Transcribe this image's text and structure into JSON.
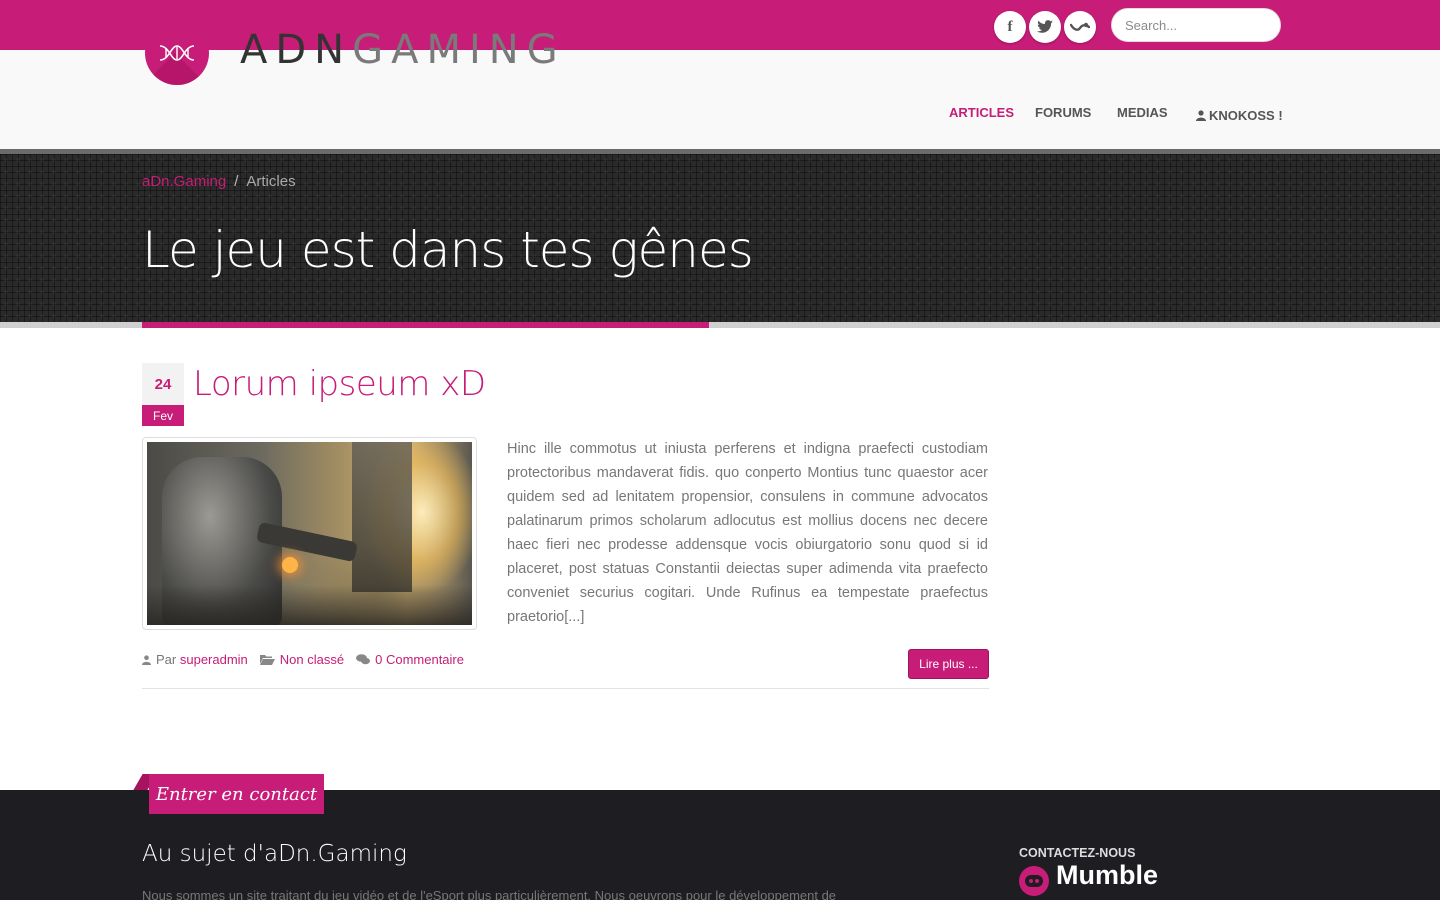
{
  "topbar": {
    "social": [
      {
        "name": "facebook",
        "icon": "facebook-icon",
        "glyph": "f"
      },
      {
        "name": "twitter",
        "icon": "twitter-icon"
      },
      {
        "name": "steam",
        "icon": "steam-icon"
      }
    ],
    "search_placeholder": "Search..."
  },
  "header": {
    "logo_text_primary": "ADN",
    "logo_text_secondary": "GAMING",
    "nav": [
      {
        "label": "ARTICLES",
        "active": true
      },
      {
        "label": "FORUMS",
        "active": false
      },
      {
        "label": "MEDIAS",
        "active": false
      },
      {
        "label": "KNOKOSS !",
        "active": false,
        "icon": "user-icon"
      }
    ]
  },
  "hero": {
    "breadcrumb": {
      "home": "aDn.Gaming",
      "separator": "/",
      "current": "Articles"
    },
    "title": "Le jeu est dans tes gênes"
  },
  "post": {
    "date_day": "24",
    "date_month": "Fev",
    "title": "Lorum ipseum xD",
    "excerpt": "Hinc ille commotus ut iniusta perferens et indigna praefecti custodiam protectoribus mandaverat fidis. quo conperto Montius tunc quaestor acer quidem sed ad lenitatem propensior, consulens in commune advocatos palatinarum primos scholarum adlocutus est mollius docens nec decere haec fieri nec prodesse addensque vocis obiurgatorio sonu quod si id placeret, post statuas Constantii deiectas super adimenda vita praefecto conveniet securius cogitari. Unde Rufinus ea tempestate praefectus praetorio[...]",
    "meta": {
      "by_label": "Par",
      "author": "superadmin",
      "category": "Non classé",
      "comments": "0 Commentaire"
    },
    "read_more": "Lire plus ..."
  },
  "footer": {
    "contact_tab": "Entrer en contact",
    "about_title": "Au sujet d'aDn.Gaming",
    "about_text": "Nous sommes un site traitant du jeu vidéo et de l'eSport plus particulièrement. Nous oeuvrons pour le développement de",
    "contact_heading": "CONTACTEZ-NOUS",
    "mumble_label": "Mumble"
  },
  "colors": {
    "accent": "#c71c77",
    "dark": "#1e1d22",
    "hero_bg": "#2a2a2a"
  }
}
